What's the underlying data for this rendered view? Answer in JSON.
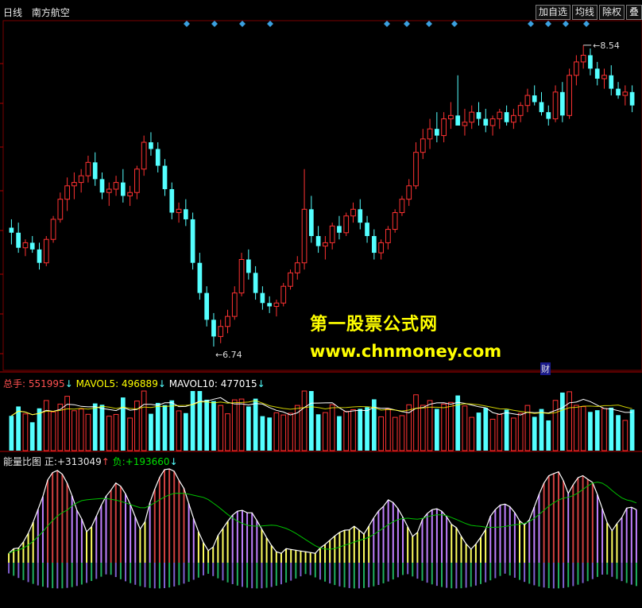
{
  "header": {
    "period": "日线",
    "stock_name": "南方航空",
    "buttons": [
      "加自选",
      "均线",
      "除权",
      "叠"
    ]
  },
  "price_annotations": {
    "high": "8.54",
    "low": "6.74"
  },
  "badge": "财",
  "watermark": {
    "line1": "第一股票公式网",
    "line2": "www.chnmoney.com"
  },
  "volume_panel": {
    "label_total": "总手:",
    "total_value": "551995",
    "mavol5_label": "MAVOL5:",
    "mavol5_value": "496889",
    "mavol10_label": "MAVOL10:",
    "mavol10_value": "477015",
    "arrow_down": "↓"
  },
  "energy_panel": {
    "title": "能量比图",
    "pos_label": "正:",
    "pos_value": "+313049",
    "neg_label": "负:",
    "neg_value": "+193660",
    "arrow_up": "↑",
    "arrow_down": "↓"
  },
  "colors": {
    "up": "#ff3232",
    "down": "#54ffff",
    "ma": "#ffffff",
    "ma2": "#ffff00",
    "pos_line": "#00c000",
    "bg": "#000000",
    "grid": "#7a0000"
  },
  "chart_data": [
    {
      "type": "candlestick",
      "title": "南方航空 日线",
      "ohlc": [
        [
          7.45,
          7.5,
          7.35,
          7.42
        ],
        [
          7.42,
          7.48,
          7.3,
          7.33
        ],
        [
          7.33,
          7.38,
          7.28,
          7.36
        ],
        [
          7.36,
          7.4,
          7.3,
          7.32
        ],
        [
          7.32,
          7.36,
          7.2,
          7.24
        ],
        [
          7.24,
          7.4,
          7.22,
          7.38
        ],
        [
          7.38,
          7.52,
          7.36,
          7.5
        ],
        [
          7.5,
          7.66,
          7.48,
          7.62
        ],
        [
          7.62,
          7.75,
          7.55,
          7.7
        ],
        [
          7.7,
          7.78,
          7.62,
          7.72
        ],
        [
          7.72,
          7.8,
          7.66,
          7.76
        ],
        [
          7.76,
          7.88,
          7.72,
          7.84
        ],
        [
          7.84,
          7.9,
          7.7,
          7.74
        ],
        [
          7.74,
          7.78,
          7.62,
          7.66
        ],
        [
          7.66,
          7.72,
          7.58,
          7.68
        ],
        [
          7.68,
          7.76,
          7.64,
          7.72
        ],
        [
          7.72,
          7.8,
          7.6,
          7.64
        ],
        [
          7.64,
          7.7,
          7.58,
          7.66
        ],
        [
          7.66,
          7.82,
          7.62,
          7.8
        ],
        [
          7.8,
          8.0,
          7.76,
          7.96
        ],
        [
          7.96,
          8.02,
          7.88,
          7.92
        ],
        [
          7.92,
          7.96,
          7.78,
          7.82
        ],
        [
          7.82,
          7.86,
          7.64,
          7.68
        ],
        [
          7.68,
          7.72,
          7.5,
          7.54
        ],
        [
          7.54,
          7.6,
          7.48,
          7.56
        ],
        [
          7.56,
          7.62,
          7.46,
          7.5
        ],
        [
          7.5,
          7.54,
          7.2,
          7.24
        ],
        [
          7.24,
          7.3,
          7.02,
          7.06
        ],
        [
          7.06,
          7.1,
          6.86,
          6.9
        ],
        [
          6.9,
          6.94,
          6.74,
          6.8
        ],
        [
          6.8,
          6.9,
          6.76,
          6.86
        ],
        [
          6.86,
          6.96,
          6.82,
          6.92
        ],
        [
          6.92,
          7.1,
          6.9,
          7.06
        ],
        [
          7.06,
          7.3,
          7.04,
          7.26
        ],
        [
          7.26,
          7.32,
          7.14,
          7.18
        ],
        [
          7.18,
          7.22,
          7.02,
          7.06
        ],
        [
          7.06,
          7.1,
          6.96,
          7.0
        ],
        [
          7.0,
          7.04,
          6.94,
          6.98
        ],
        [
          6.98,
          7.02,
          6.92,
          7.0
        ],
        [
          7.0,
          7.12,
          6.98,
          7.1
        ],
        [
          7.1,
          7.2,
          7.08,
          7.18
        ],
        [
          7.18,
          7.28,
          7.14,
          7.24
        ],
        [
          7.24,
          7.8,
          7.2,
          7.56
        ],
        [
          7.56,
          7.64,
          7.36,
          7.4
        ],
        [
          7.4,
          7.46,
          7.3,
          7.34
        ],
        [
          7.34,
          7.4,
          7.26,
          7.36
        ],
        [
          7.36,
          7.48,
          7.32,
          7.46
        ],
        [
          7.46,
          7.52,
          7.38,
          7.42
        ],
        [
          7.42,
          7.54,
          7.4,
          7.52
        ],
        [
          7.52,
          7.6,
          7.48,
          7.56
        ],
        [
          7.56,
          7.62,
          7.44,
          7.48
        ],
        [
          7.48,
          7.52,
          7.36,
          7.4
        ],
        [
          7.4,
          7.44,
          7.26,
          7.3
        ],
        [
          7.3,
          7.38,
          7.26,
          7.36
        ],
        [
          7.36,
          7.46,
          7.32,
          7.44
        ],
        [
          7.44,
          7.56,
          7.42,
          7.54
        ],
        [
          7.54,
          7.64,
          7.52,
          7.62
        ],
        [
          7.62,
          7.74,
          7.58,
          7.7
        ],
        [
          7.7,
          7.96,
          7.68,
          7.9
        ],
        [
          7.9,
          8.04,
          7.86,
          7.98
        ],
        [
          7.98,
          8.1,
          7.92,
          8.04
        ],
        [
          8.04,
          8.14,
          7.96,
          8.0
        ],
        [
          8.0,
          8.14,
          7.96,
          8.1
        ],
        [
          8.1,
          8.2,
          8.04,
          8.12
        ],
        [
          8.12,
          8.36,
          8.1,
          8.06
        ],
        [
          8.06,
          8.16,
          8.0,
          8.08
        ],
        [
          8.08,
          8.18,
          8.04,
          8.14
        ],
        [
          8.14,
          8.2,
          8.06,
          8.1
        ],
        [
          8.1,
          8.16,
          8.02,
          8.06
        ],
        [
          8.06,
          8.12,
          8.0,
          8.1
        ],
        [
          8.1,
          8.16,
          8.04,
          8.14
        ],
        [
          8.14,
          8.18,
          8.06,
          8.08
        ],
        [
          8.08,
          8.16,
          8.04,
          8.12
        ],
        [
          8.12,
          8.2,
          8.08,
          8.18
        ],
        [
          8.18,
          8.28,
          8.14,
          8.24
        ],
        [
          8.24,
          8.3,
          8.18,
          8.2
        ],
        [
          8.2,
          8.26,
          8.12,
          8.14
        ],
        [
          8.14,
          8.18,
          8.06,
          8.1
        ],
        [
          8.1,
          8.3,
          8.08,
          8.26
        ],
        [
          8.26,
          8.32,
          8.08,
          8.12
        ],
        [
          8.12,
          8.4,
          8.1,
          8.36
        ],
        [
          8.36,
          8.48,
          8.3,
          8.44
        ],
        [
          8.44,
          8.54,
          8.4,
          8.48
        ],
        [
          8.48,
          8.52,
          8.36,
          8.4
        ],
        [
          8.4,
          8.44,
          8.3,
          8.34
        ],
        [
          8.34,
          8.4,
          8.28,
          8.36
        ],
        [
          8.36,
          8.42,
          8.24,
          8.28
        ],
        [
          8.28,
          8.32,
          8.22,
          8.24
        ],
        [
          8.24,
          8.3,
          8.18,
          8.26
        ],
        [
          8.26,
          8.3,
          8.14,
          8.18
        ]
      ],
      "high_label": "8.54",
      "low_label": "6.74"
    },
    {
      "type": "bar",
      "title": "总手",
      "series": [
        {
          "name": "MAVOL5",
          "value": 496889
        },
        {
          "name": "MAVOL10",
          "value": 477015
        }
      ],
      "last_volume": 551995
    },
    {
      "type": "bar",
      "title": "能量比图",
      "series": [
        {
          "name": "正",
          "value": 313049
        },
        {
          "name": "负",
          "value": 193660
        }
      ]
    }
  ]
}
